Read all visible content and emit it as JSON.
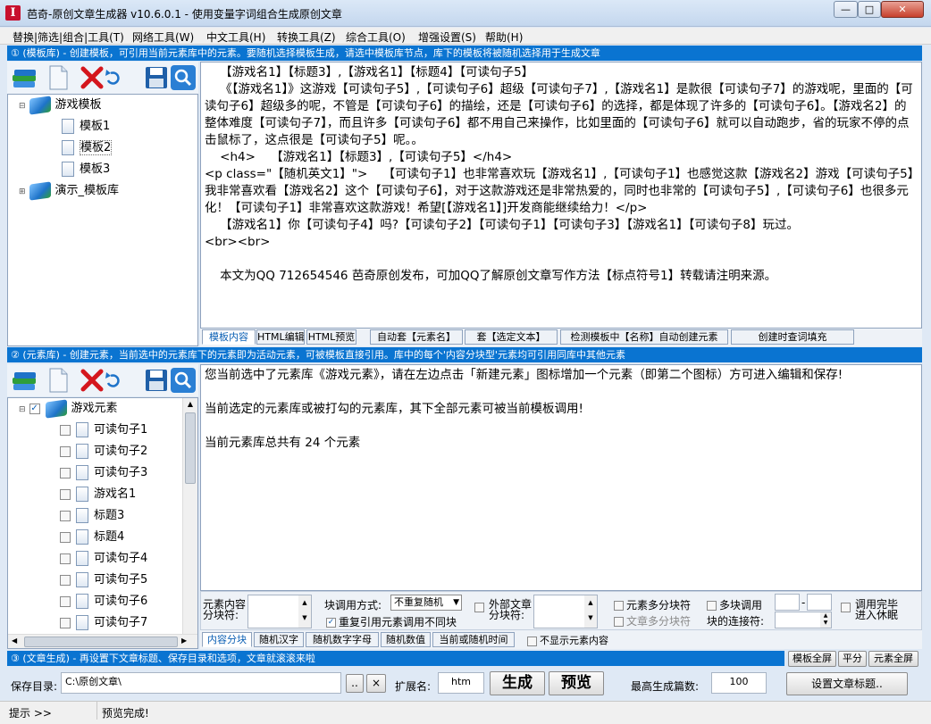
{
  "window": {
    "title": "芭奇-原创文章生成器 v10.6.0.1 - 使用变量字词组合生成原创文章",
    "icon_letter": "I",
    "btn_minimize": "—",
    "btn_maximize": "□",
    "btn_close": "✕"
  },
  "menu": [
    "替换|筛选|组合|工具(T)",
    "网络工具(W)",
    "中文工具(H)",
    "转换工具(Z)",
    "综合工具(O)",
    "增强设置(S)",
    "帮助(H)"
  ],
  "section1": {
    "banner": "① (模板库) - 创建模板，可引用当前元素库中的元素。要随机选择模板生成，请选中模板库节点，库下的模板将被随机选择用于生成文章",
    "tree": {
      "root": "游戏模板",
      "items": [
        "模板1",
        "模板2",
        "模板3"
      ],
      "demo": "演示_模板库"
    },
    "content_lines": [
      "    【游戏名1】【标题3】,【游戏名1】【标题4】【可读句子5】",
      "    《【游戏名1】》这游戏【可读句子5】,【可读句子6】超级【可读句子7】,【游戏名1】是款很【可读句子7】的游戏呢，里面的【可读句子6】超级多的呢，不管是【可读句子6】的描绘，还是【可读句子6】的选择，都是体现了许多的【可读句子6】。【游戏名2】的整体难度【可读句子7】，而且许多【可读句子6】都不用自己来操作，比如里面的【可读句子6】就可以自动跑步，省的玩家不停的点击鼠标了，这点很是【可读句子5】呢。。",
      "    <h4>    【游戏名1】【标题3】,【可读句子5】</h4>",
      "<p class=\"【随机英文1】\">    【可读句子1】也非常喜欢玩【游戏名1】,【可读句子1】也感觉这款【游戏名2】游戏【可读句子5】我非常喜欢看【游戏名2】这个【可读句子6】，对于这款游戏还是非常热爱的，同时也非常的【可读句子5】,【可读句子6】也很多元化！【可读句子1】非常喜欢这款游戏！希望[【游戏名1】]开发商能继续给力！</p>",
      "    【游戏名1】你【可读句子4】吗?【可读句子2】【可读句子1】【可读句子3】【游戏名1】【可读句子8】玩过。",
      "<br><br>",
      "",
      "    本文为QQ 712654546 芭奇原创发布，可加QQ了解原创文章写作方法【标点符号1】转载请注明来源。"
    ],
    "tabs": [
      "模板内容",
      "HTML编辑",
      "HTML预览"
    ],
    "actions": [
      "自动套【元素名】",
      "套【选定文本】",
      "检测模板中【名称】自动创建元素",
      "创建时查词填充"
    ]
  },
  "section2": {
    "banner": "② (元素库) - 创建元素，当前选中的元素库下的元素即为活动元素，可被模板直接引用。库中的每个'内容分块型'元素均可引用同库中其他元素",
    "tree": {
      "root": "游戏元素",
      "items": [
        "可读句子1",
        "可读句子2",
        "可读句子3",
        "游戏名1",
        "标题3",
        "标题4",
        "可读句子4",
        "可读句子5",
        "可读句子6",
        "可读句子7"
      ]
    },
    "info_lines": [
      "您当前选中了元素库《游戏元素》，请在左边点击「新建元素」图标增加一个元素（即第二个图标）方可进入编辑和保存!",
      "",
      "当前选定的元素库或被打勾的元素库，其下全部元素可被当前模板调用!",
      "",
      "当前元素库总共有 24 个元素"
    ],
    "options": {
      "content_block_label": "元素内容分块符:",
      "block_call_label": "块调用方式:",
      "block_call_value": "不重复随机",
      "repeat_ref": "重复引用元素调用不同块",
      "external_label": "外部文章分块符:",
      "multi_element": "元素多分块符",
      "multi_article": "文章多分块符",
      "multi_call": "多块调用",
      "block_joiner": "块的连接符:",
      "range_sep": "-",
      "call_finish": "调用完毕进入休眠"
    },
    "tabs": [
      "内容分块",
      "随机汉字",
      "随机数字字母",
      "随机数值",
      "当前或随机时间"
    ],
    "hide_content": "不显示元素内容"
  },
  "section3": {
    "banner": "③ (文章生成) - 再设置下文章标题、保存目录和选项，文章就滚滚来啦",
    "fullscreen": [
      "模板全屏",
      "平分",
      "元素全屏"
    ],
    "save_label": "保存目录:",
    "save_path": "C:\\原创文章\\",
    "browse": "..",
    "clear": "×",
    "ext_label": "扩展名:",
    "ext_value": "htm",
    "generate": "生成",
    "preview": "预览",
    "max_label": "最高生成篇数:",
    "max_value": "100",
    "set_title": "设置文章标题.."
  },
  "status": {
    "hint": "提示 >>",
    "message": "预览完成!"
  }
}
